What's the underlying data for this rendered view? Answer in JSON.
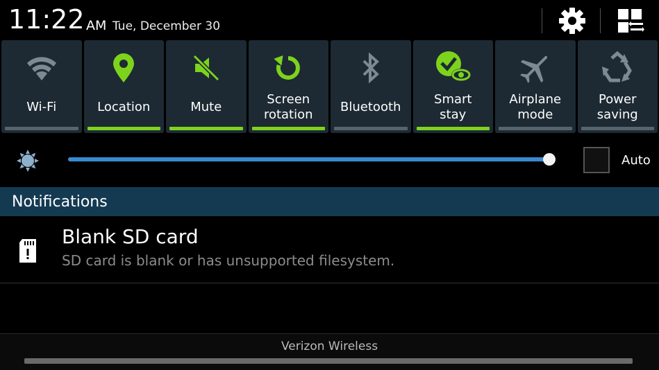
{
  "status": {
    "time": "11:22",
    "ampm": "AM",
    "date": "Tue, December 30"
  },
  "header_icons": {
    "settings": "gear-icon",
    "grid": "grid-toggle-icon"
  },
  "colors": {
    "accent_on": "#7dd31c",
    "toggle_bg": "#1d2a33",
    "slider": "#3a8ad0",
    "notif_header": "#143a52"
  },
  "toggles": [
    {
      "label": "Wi-Fi",
      "icon": "wifi-icon",
      "on": false
    },
    {
      "label": "Location",
      "icon": "location-pin-icon",
      "on": true
    },
    {
      "label": "Mute",
      "icon": "mute-icon",
      "on": true
    },
    {
      "label": "Screen\nrotation",
      "icon": "rotation-icon",
      "on": true
    },
    {
      "label": "Bluetooth",
      "icon": "bluetooth-icon",
      "on": false
    },
    {
      "label": "Smart\nstay",
      "icon": "smart-stay-icon",
      "on": true
    },
    {
      "label": "Airplane\nmode",
      "icon": "airplane-icon",
      "on": false
    },
    {
      "label": "Power\nsaving",
      "icon": "recycle-icon",
      "on": false
    }
  ],
  "brightness": {
    "level": 0.995,
    "auto_label": "Auto",
    "auto_checked": false
  },
  "notifications": {
    "header": "Notifications",
    "items": [
      {
        "title": "Blank SD card",
        "text": "SD card is blank or has unsupported filesystem.",
        "icon": "sd-card-warning-icon"
      }
    ]
  },
  "carrier": "Verizon Wireless"
}
